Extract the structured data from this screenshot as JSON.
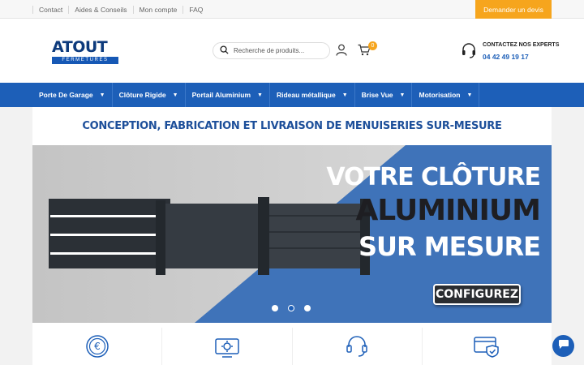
{
  "topbar": {
    "links": [
      "Contact",
      "Aides & Conseils",
      "Mon compte",
      "FAQ"
    ],
    "quote_button": "Demander un devis"
  },
  "header": {
    "logo_top": "ATOUT",
    "logo_bottom": "FERMETURES",
    "search_placeholder": "Recherche de produits...",
    "cart_count": "0",
    "expert_label": "CONTACTEZ NOS EXPERTS",
    "expert_phone": "04 42 49 19 17"
  },
  "nav": {
    "items": [
      {
        "label": "Porte De Garage"
      },
      {
        "label": "Clôture Rigide"
      },
      {
        "label": "Portail Aluminium"
      },
      {
        "label": "Rideau métallique"
      },
      {
        "label": "Brise Vue"
      },
      {
        "label": "Motorisation"
      }
    ]
  },
  "main": {
    "headline": "CONCEPTION, FABRICATION ET LIVRAISON DE MENUISERIES SUR-MESURE",
    "banner": {
      "line1": "VOTRE CLÔTURE",
      "line2": "ALUMINIUM",
      "line3": "SUR MESURE",
      "cta": "CONFIGUREZ",
      "slide_count": 3,
      "active_slide": 2
    },
    "features": [
      "euro-icon",
      "settings-monitor-icon",
      "headset-icon",
      "card-shield-icon"
    ]
  },
  "colors": {
    "brand_blue": "#1d5fb8",
    "accent_orange": "#f6a51d"
  }
}
